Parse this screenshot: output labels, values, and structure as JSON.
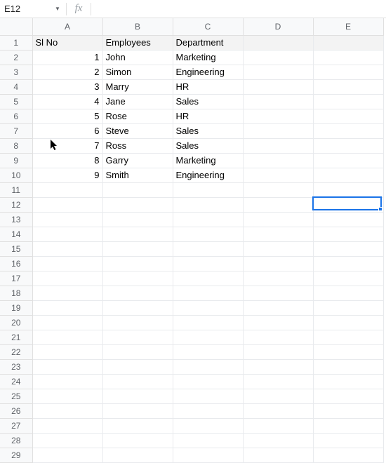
{
  "formulaBar": {
    "nameBox": "E12",
    "fxLabel": "fx",
    "formula": ""
  },
  "columns": [
    "A",
    "B",
    "C",
    "D",
    "E"
  ],
  "rowCount": 29,
  "headers": {
    "c1": "Sl No",
    "c2": "Employees",
    "c3": "Department"
  },
  "rows": [
    {
      "n": "1",
      "emp": "John",
      "dep": "Marketing"
    },
    {
      "n": "2",
      "emp": "Simon",
      "dep": "Engineering"
    },
    {
      "n": "3",
      "emp": "Marry",
      "dep": "HR"
    },
    {
      "n": "4",
      "emp": "Jane",
      "dep": "Sales"
    },
    {
      "n": "5",
      "emp": "Rose",
      "dep": "HR"
    },
    {
      "n": "6",
      "emp": "Steve",
      "dep": "Sales"
    },
    {
      "n": "7",
      "emp": "Ross",
      "dep": "Sales"
    },
    {
      "n": "8",
      "emp": "Garry",
      "dep": "Marketing"
    },
    {
      "n": "9",
      "emp": "Smith",
      "dep": "Engineering"
    }
  ],
  "selection": {
    "cell": "E12"
  },
  "cursor": {
    "row": 8,
    "colPx": 72
  }
}
